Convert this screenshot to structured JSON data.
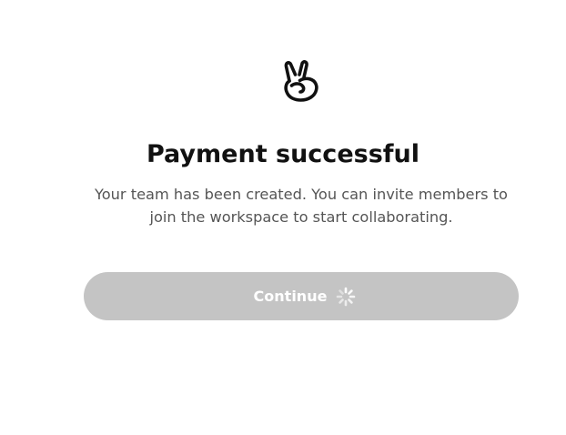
{
  "logo": {
    "icon": "peace-hand-icon"
  },
  "title": "Payment successful",
  "subtitle": "Your team has been created. You can invite members to join the workspace to start collaborating.",
  "continue_button": {
    "label": "Continue",
    "state": "loading",
    "icon": "loading-spinner-icon"
  },
  "colors": {
    "button_background": "#c4c4c4",
    "button_text": "#ffffff",
    "title": "#111111",
    "subtitle": "#555555"
  }
}
